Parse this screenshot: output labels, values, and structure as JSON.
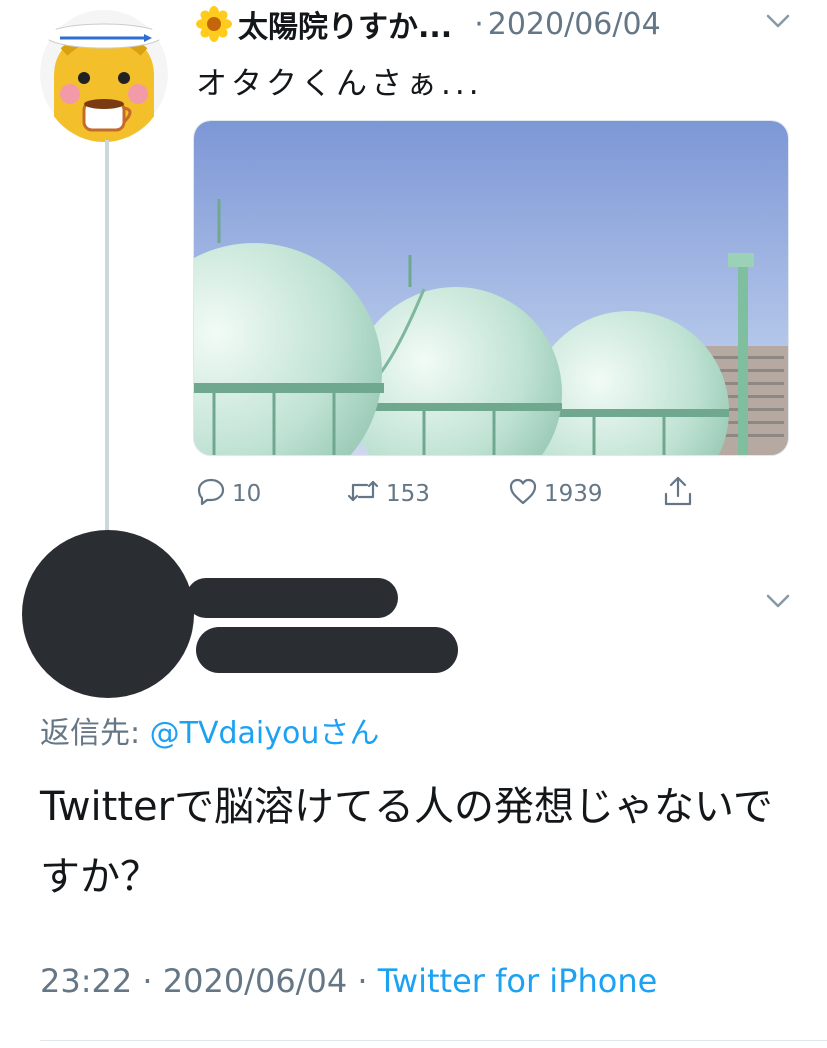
{
  "parent_tweet": {
    "display_name": "太陽院りすか...",
    "separator": "·",
    "date": "2020/06/04",
    "text": "オタクくんさぁ...",
    "actions": {
      "reply_count": "10",
      "retweet_count": "153",
      "like_count": "1939"
    }
  },
  "reply_tweet": {
    "reply_to_label": "返信先: ",
    "reply_to_handle": "@TVdaiyou",
    "reply_to_suffix": "さん",
    "text": "Twitterで脳溶けてる人の発想じゃないですか？",
    "time": "23:22",
    "sep1": " · ",
    "date": "2020/06/04",
    "sep2": " · ",
    "client": "Twitter for iPhone"
  },
  "colors": {
    "accent": "#1da1f2",
    "muted": "#657786",
    "text": "#14171a",
    "redaction": "#2a2e33"
  },
  "icons": [
    "flower-icon",
    "chevron-down-icon",
    "reply-icon",
    "retweet-icon",
    "like-icon",
    "share-icon"
  ]
}
